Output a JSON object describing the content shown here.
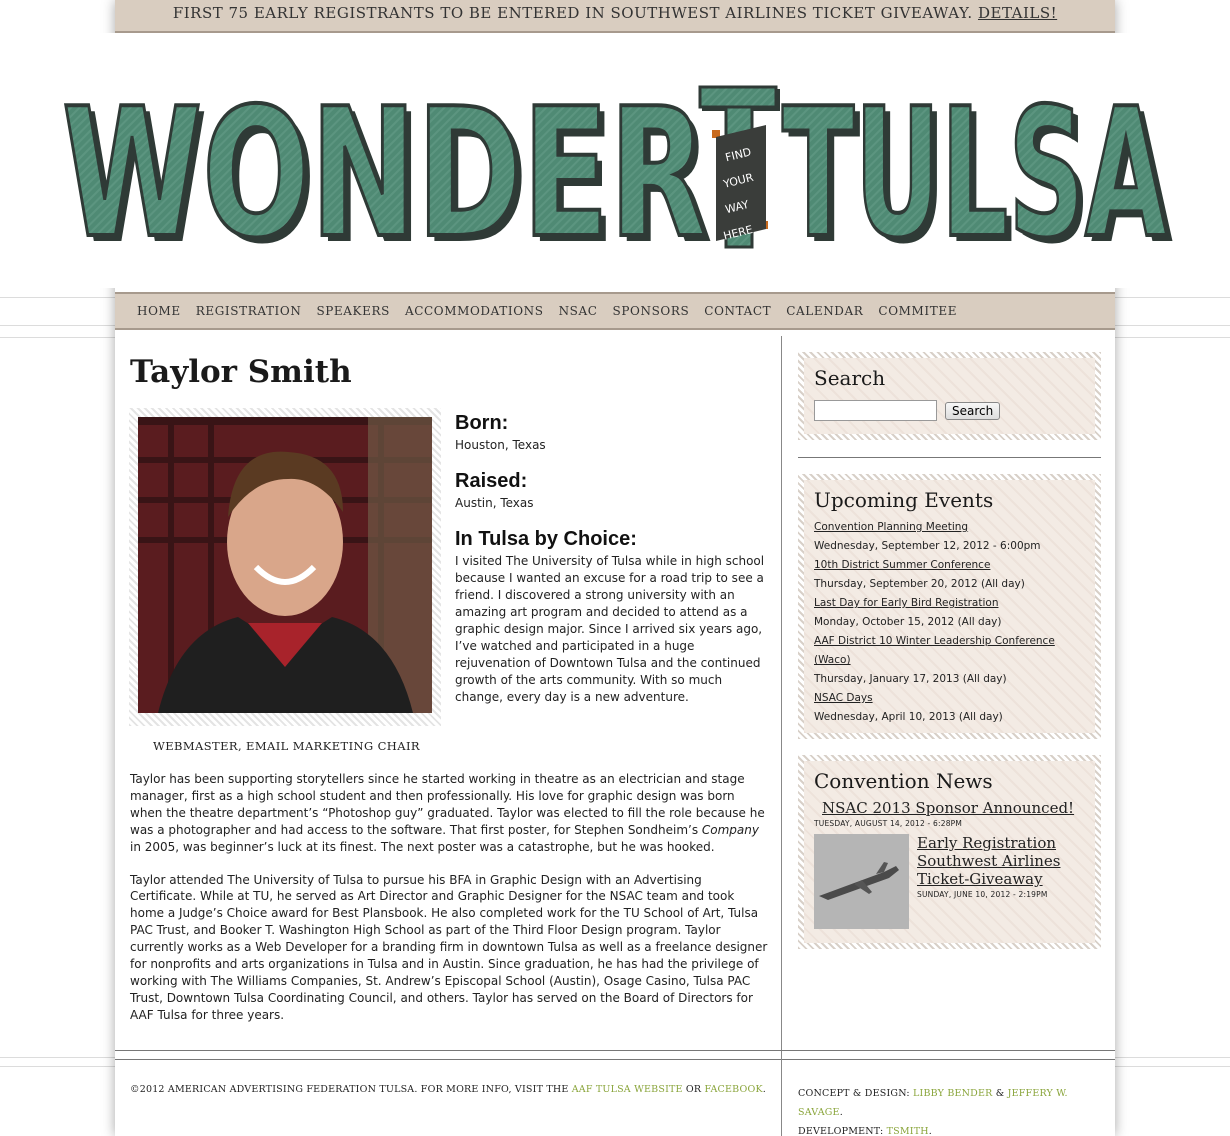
{
  "announcement": {
    "text": "FIRST 75 EARLY REGISTRANTS TO BE ENTERED IN SOUTHWEST AIRLINES TICKET GIVEAWAY.",
    "link": "DETAILS!"
  },
  "logo": {
    "left_text": "WONDER",
    "right_text": "TULSA",
    "banner": [
      "FIND",
      "YOUR",
      "WAY",
      "HERE"
    ],
    "colors": {
      "fill": "#4f8a74",
      "shadow": "#2f3a36",
      "outline": "#a9c9b4",
      "banner": "#3a3d3a",
      "ribbon": "#c86a1e"
    }
  },
  "nav": [
    "HOME",
    "REGISTRATION",
    "SPEAKERS",
    "ACCOMMODATIONS",
    "NSAC",
    "SPONSORS",
    "CONTACT",
    "CALENDAR",
    "COMMITEE"
  ],
  "profile": {
    "name": "Taylor Smith",
    "caption": "WEBMASTER, EMAIL MARKETING CHAIR",
    "born_label": "Born:",
    "born": "Houston, Texas",
    "raised_label": "Raised:",
    "raised": "Austin, Texas",
    "choice_label": "In Tulsa by Choice:",
    "choice": "I visited The University of Tulsa while in high school because I wanted an excuse for a road trip to see a friend. I discovered a strong university with an amazing art program and decided to attend as a graphic design major. Since I arrived six years ago, I’ve watched and participated in a huge rejuvenation of Downtown Tulsa and the continued growth of the arts community. With so much change, every day is a new adventure.",
    "bio1_a": "Taylor has been supporting storytellers since he started working in theatre as an electrician and stage manager, first as a high school student and then professionally. His love for graphic design was born when the theatre department’s “Photoshop guy” graduated. Taylor was elected to fill the role because he was a photographer and had access to the software. That first poster, for Stephen Sondheim’s ",
    "bio1_em": "Company",
    "bio1_b": " in 2005, was beginner’s luck at its finest. The next poster was a catastrophe, but he was hooked.",
    "bio2": "Taylor attended The University of Tulsa to pursue his BFA in Graphic Design with an Advertising Certificate. While at TU, he served as Art Director and Graphic Designer for the NSAC team and took home a Judge’s Choice award for Best Plansbook. He also completed work for the TU School of Art, Tulsa PAC Trust, and Booker T. Washington High School as part of the Third Floor Design program. Taylor currently works as a Web Developer for a branding firm in downtown Tulsa as well as a freelance designer for nonprofits and arts organizations in Tulsa and in Austin. Since graduation, he has had the privilege of working with The Williams Companies, St. Andrew’s Episcopal School (Austin), Osage Casino, Tulsa PAC Trust, Downtown Tulsa Coordinating Council, and others. Taylor has served on the Board of Directors for AAF Tulsa for three years."
  },
  "search": {
    "title": "Search",
    "button": "Search",
    "value": ""
  },
  "events": {
    "title": "Upcoming Events",
    "items": [
      {
        "name": "Convention Planning Meeting",
        "date": "Wednesday, September 12, 2012 - 6:00pm"
      },
      {
        "name": "10th District Summer Conference",
        "date": "Thursday, September 20, 2012 (All day)"
      },
      {
        "name": "Last Day for Early Bird Registration",
        "date": "Monday, October 15, 2012 (All day)"
      },
      {
        "name": "AAF District 10 Winter Leadership Conference (Waco)",
        "date": "Thursday, January 17, 2013 (All day)"
      },
      {
        "name": "NSAC Days",
        "date": "Wednesday, April 10, 2013 (All day)"
      }
    ]
  },
  "news": {
    "title": "Convention News",
    "item1_title": "NSAC 2013 Sponsor Announced!",
    "item1_date": "TUESDAY, AUGUST 14, 2012 - 6:28PM",
    "item2_title": "Early Registration Southwest Airlines Ticket-Giveaway",
    "item2_date": "SUNDAY, JUNE 10, 2012 - 2:19PM"
  },
  "footer": {
    "left_a": "©2012 AMERICAN ADVERTISING FEDERATION TULSA. FOR MORE INFO, VISIT THE ",
    "left_link1": "AAF TULSA WEBSITE",
    "left_or": " OR ",
    "left_link2": "FACEBOOK",
    "left_end": ".",
    "concept_label": "CONCEPT & DESIGN: ",
    "designer1": "LIBBY BENDER",
    "amp": " & ",
    "designer2": "JEFFERY W. SAVAGE",
    "dev_label": "DEVELOPMENT: ",
    "developer": "TSMITH"
  }
}
